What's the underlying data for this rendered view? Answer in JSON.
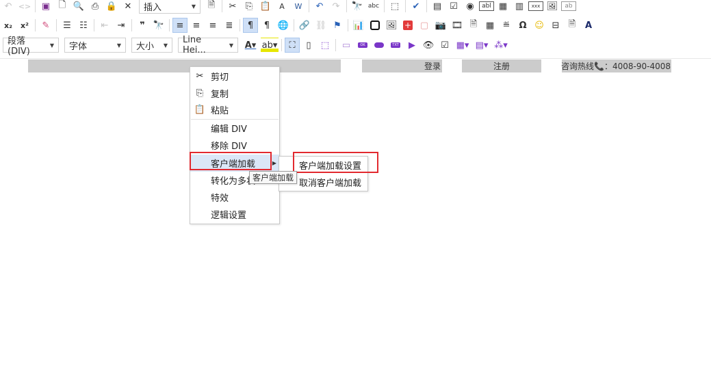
{
  "toolbar": {
    "insert_combo": "插入",
    "paragraph_combo": "段落(DIV)",
    "font_combo": "字体",
    "size_combo": "大小",
    "lineheight_combo": "Line Hei...",
    "icons_row1": [
      "undo-icon",
      "source-code-icon",
      "save-icon",
      "new-document-icon",
      "preview-icon",
      "print-icon",
      "lock-icon",
      "close-icon",
      "template-icon",
      "cut-icon",
      "copy-icon",
      "paste-icon",
      "paste-text-icon",
      "paste-word-icon",
      "undo-arrow-icon",
      "redo-arrow-icon",
      "find-icon",
      "spellcheck-icon",
      "select-all-icon",
      "check-spelling-icon",
      "form-icon",
      "checkbox-icon",
      "radio-icon",
      "textfield-icon",
      "textarea-icon",
      "select-field-icon",
      "button-field-icon",
      "image-button-icon",
      "hidden-field-icon"
    ],
    "icons_row2": [
      "subscript-icon",
      "superscript-icon",
      "remove-format-icon",
      "numbered-list-icon",
      "bulleted-list-icon",
      "outdent-icon",
      "indent-icon",
      "blockquote-icon",
      "find-replace-icon",
      "align-left-icon",
      "align-center-icon",
      "align-right-icon",
      "justify-icon",
      "ltr-icon",
      "rtl-icon",
      "language-icon",
      "link-icon",
      "unlink-icon",
      "anchor-icon",
      "chart-icon",
      "flash-icon",
      "image-icon",
      "add-icon",
      "iframe-icon",
      "camera-icon",
      "film-icon",
      "document-icon",
      "table-icon",
      "horizontal-rule-icon",
      "special-char-icon",
      "smiley-icon",
      "page-break-icon",
      "page-icon",
      "text-color-a-icon"
    ],
    "icons_row3": [
      "font-color-icon",
      "bg-color-icon",
      "maximize-icon",
      "show-blocks-icon",
      "about-icon",
      "div-icon",
      "ok-badge-icon",
      "round-badge-icon",
      "txt-badge-icon",
      "play-icon",
      "visibility-icon",
      "verify-icon",
      "grid-icon",
      "layout-icon",
      "spark-icon"
    ],
    "tb_text": {
      "x2": "x₂",
      "x_sup": "x²",
      "quote": "❞",
      "omega": "Ω",
      "ok": "OK",
      "txt": "TXT",
      "abl": "abl",
      "xxx": "xxx",
      "ab": "ab",
      "abc": "abc",
      "plus": "+"
    }
  },
  "header_bar": {
    "login": "登录",
    "register": "注册",
    "hotline": "咨询热线📞：4008-90-4008"
  },
  "context_menu": {
    "items": [
      {
        "label": "剪切",
        "icon": "cut-icon"
      },
      {
        "label": "复制",
        "icon": "copy-icon"
      },
      {
        "label": "粘贴",
        "icon": "paste-icon"
      },
      {
        "label": "编辑 DIV"
      },
      {
        "label": "移除 DIV"
      },
      {
        "label": "客户端加载",
        "has_submenu": true,
        "highlighted": true
      },
      {
        "label": "转化为多状"
      },
      {
        "label": "特效"
      },
      {
        "label": "逻辑设置"
      }
    ]
  },
  "submenu": {
    "items": [
      {
        "label": "客户端加载设置"
      },
      {
        "label": "取消客户端加载"
      }
    ]
  },
  "tooltip": "客户端加载",
  "colors": {
    "highlight_box": "#e2292f",
    "menu_hover": "#dbe7f7",
    "header_bar": "#cccccc",
    "active_button": "#cfe0f7"
  }
}
